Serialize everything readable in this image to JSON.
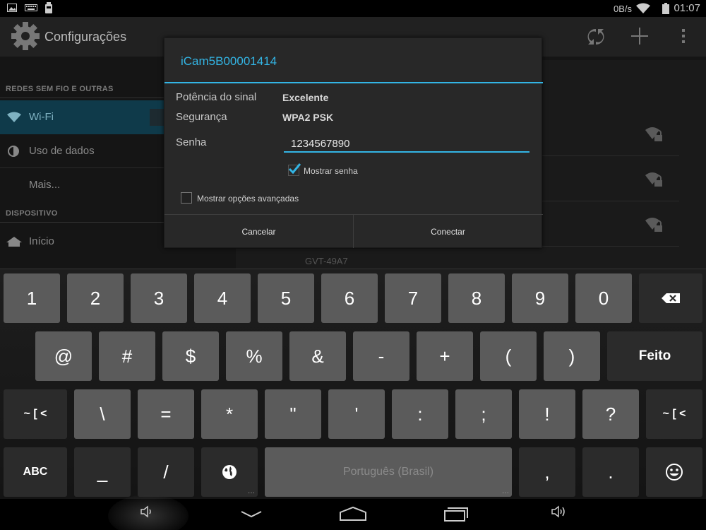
{
  "status_bar": {
    "time": "01:07",
    "data_rate": "0B/s"
  },
  "action_bar": {
    "title": "Configurações"
  },
  "settings": {
    "section_wireless": "REDES SEM FIO E OUTRAS",
    "wifi_label": "Wi-Fi",
    "data_usage_label": "Uso de dados",
    "more_label": "Mais...",
    "section_device": "DISPOSITIVO",
    "home_label": "Início",
    "partial_network": "GVT-49A7"
  },
  "dialog": {
    "title": "iCam5B00001414",
    "signal_label": "Potência do sinal",
    "signal_value": "Excelente",
    "security_label": "Segurança",
    "security_value": "WPA2 PSK",
    "password_label": "Senha",
    "password_value": "1234567890",
    "show_password_label": "Mostrar senha",
    "show_password_checked": true,
    "advanced_label": "Mostrar opções avançadas",
    "advanced_checked": false,
    "cancel_label": "Cancelar",
    "connect_label": "Conectar"
  },
  "keyboard": {
    "row1": [
      "1",
      "2",
      "3",
      "4",
      "5",
      "6",
      "7",
      "8",
      "9",
      "0"
    ],
    "row2": [
      "@",
      "#",
      "$",
      "%",
      "&",
      "-",
      "+",
      "(",
      ")"
    ],
    "done_label": "Feito",
    "row3": [
      "\\",
      "=",
      "*",
      "\"",
      "'",
      ":",
      ";",
      "!",
      "?"
    ],
    "more_symbols_label": "~ [ <",
    "abc_label": "ABC",
    "underscore": "_",
    "slash": "/",
    "space_label": "Português (Brasil)",
    "comma": ",",
    "period": "."
  },
  "colors": {
    "accent": "#33b5e5",
    "key": "#5b5b5b",
    "key_dark": "#2b2b2b"
  }
}
